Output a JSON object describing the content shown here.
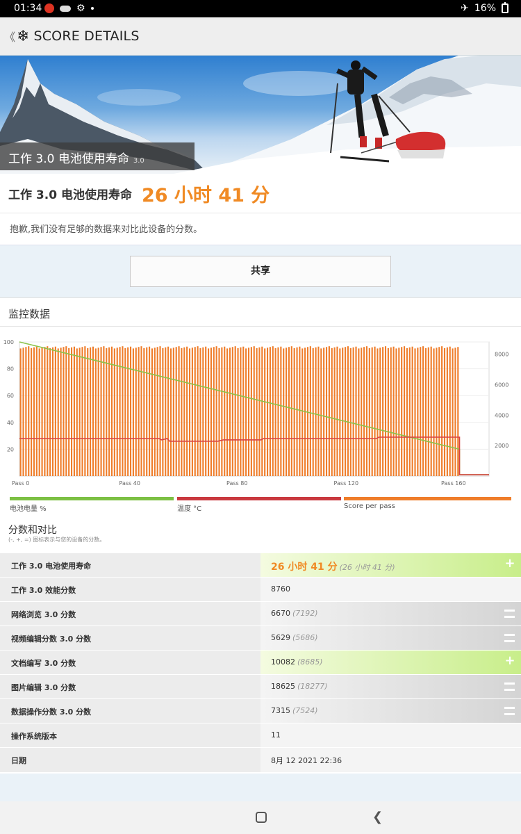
{
  "status_bar": {
    "time": "01:34",
    "battery": "16%"
  },
  "app_bar": {
    "back_glyph": "《",
    "logo_icon": "snowflake-icon",
    "title": "SCORE DETAILS"
  },
  "hero": {
    "label": "工作 3.0 电池使用寿命",
    "version": "3.0"
  },
  "score": {
    "label": "工作 3.0 电池使用寿命",
    "value": "26 小时 41 分"
  },
  "notice": "抱歉,我们没有足够的数据来对比此设备的分数。",
  "share_button": "共享",
  "monitor": {
    "title": "监控数据",
    "legend": [
      {
        "label": "电池电量 %",
        "color": "#7cc043"
      },
      {
        "label": "温度 °C",
        "color": "#c9393e"
      },
      {
        "label": "Score per pass",
        "color": "#ef7d2a"
      }
    ]
  },
  "chart_data": {
    "type": "bar",
    "title": "",
    "x_ticks": [
      "Pass 0",
      "Pass 40",
      "Pass 80",
      "Pass 120",
      "Pass 160"
    ],
    "x_range": [
      0,
      175
    ],
    "left_axis": {
      "ticks": [
        "20",
        "40",
        "60",
        "80",
        "100"
      ],
      "range": [
        0,
        100
      ]
    },
    "right_axis": {
      "ticks": [
        "2000",
        "4000",
        "6000",
        "8000"
      ],
      "range": [
        0,
        8800
      ]
    },
    "series": [
      {
        "name": "Score per pass",
        "axis": "right",
        "kind": "bars",
        "approx_value": 8500,
        "passes": 164,
        "after_passes": 0
      },
      {
        "name": "电池电量 %",
        "axis": "left",
        "kind": "line",
        "points": [
          [
            0,
            100
          ],
          [
            164,
            20
          ],
          [
            164,
            1
          ],
          [
            175,
            1
          ]
        ]
      },
      {
        "name": "温度 °C",
        "axis": "left",
        "kind": "line",
        "points": [
          [
            0,
            28
          ],
          [
            52,
            28
          ],
          [
            53,
            27
          ],
          [
            55,
            28
          ],
          [
            56,
            26
          ],
          [
            74,
            26
          ],
          [
            76,
            27
          ],
          [
            90,
            27
          ],
          [
            91,
            28
          ],
          [
            133,
            28
          ],
          [
            134,
            29
          ],
          [
            164,
            29
          ],
          [
            164,
            1
          ],
          [
            175,
            1
          ]
        ]
      }
    ],
    "grid": true
  },
  "comparison": {
    "title": "分数和对比",
    "subtitle": "(-, +, =) 图标表示与您的设备的分数。",
    "rows": [
      {
        "key": "工作 3.0 电池使用寿命",
        "value": "26 小时 41 分",
        "ref": "(26 小时 41 分)",
        "sign": "+"
      },
      {
        "key": "工作 3.0 效能分数",
        "value": "8760",
        "ref": "",
        "sign": ""
      },
      {
        "key": "网络浏览 3.0 分数",
        "value": "6670",
        "ref": "(7192)",
        "sign": "="
      },
      {
        "key": "视频编辑分数 3.0 分数",
        "value": "5629",
        "ref": "(5686)",
        "sign": "="
      },
      {
        "key": "文档编写 3.0 分数",
        "value": "10082",
        "ref": "(8685)",
        "sign": "+"
      },
      {
        "key": "图片编辑 3.0 分数",
        "value": "18625",
        "ref": "(18277)",
        "sign": "="
      },
      {
        "key": "数据操作分数 3.0 分数",
        "value": "7315",
        "ref": "(7524)",
        "sign": "="
      },
      {
        "key": "操作系统版本",
        "value": "11",
        "ref": "",
        "sign": ""
      },
      {
        "key": "日期",
        "value": "8月 12 2021 22:36",
        "ref": "",
        "sign": ""
      }
    ]
  }
}
